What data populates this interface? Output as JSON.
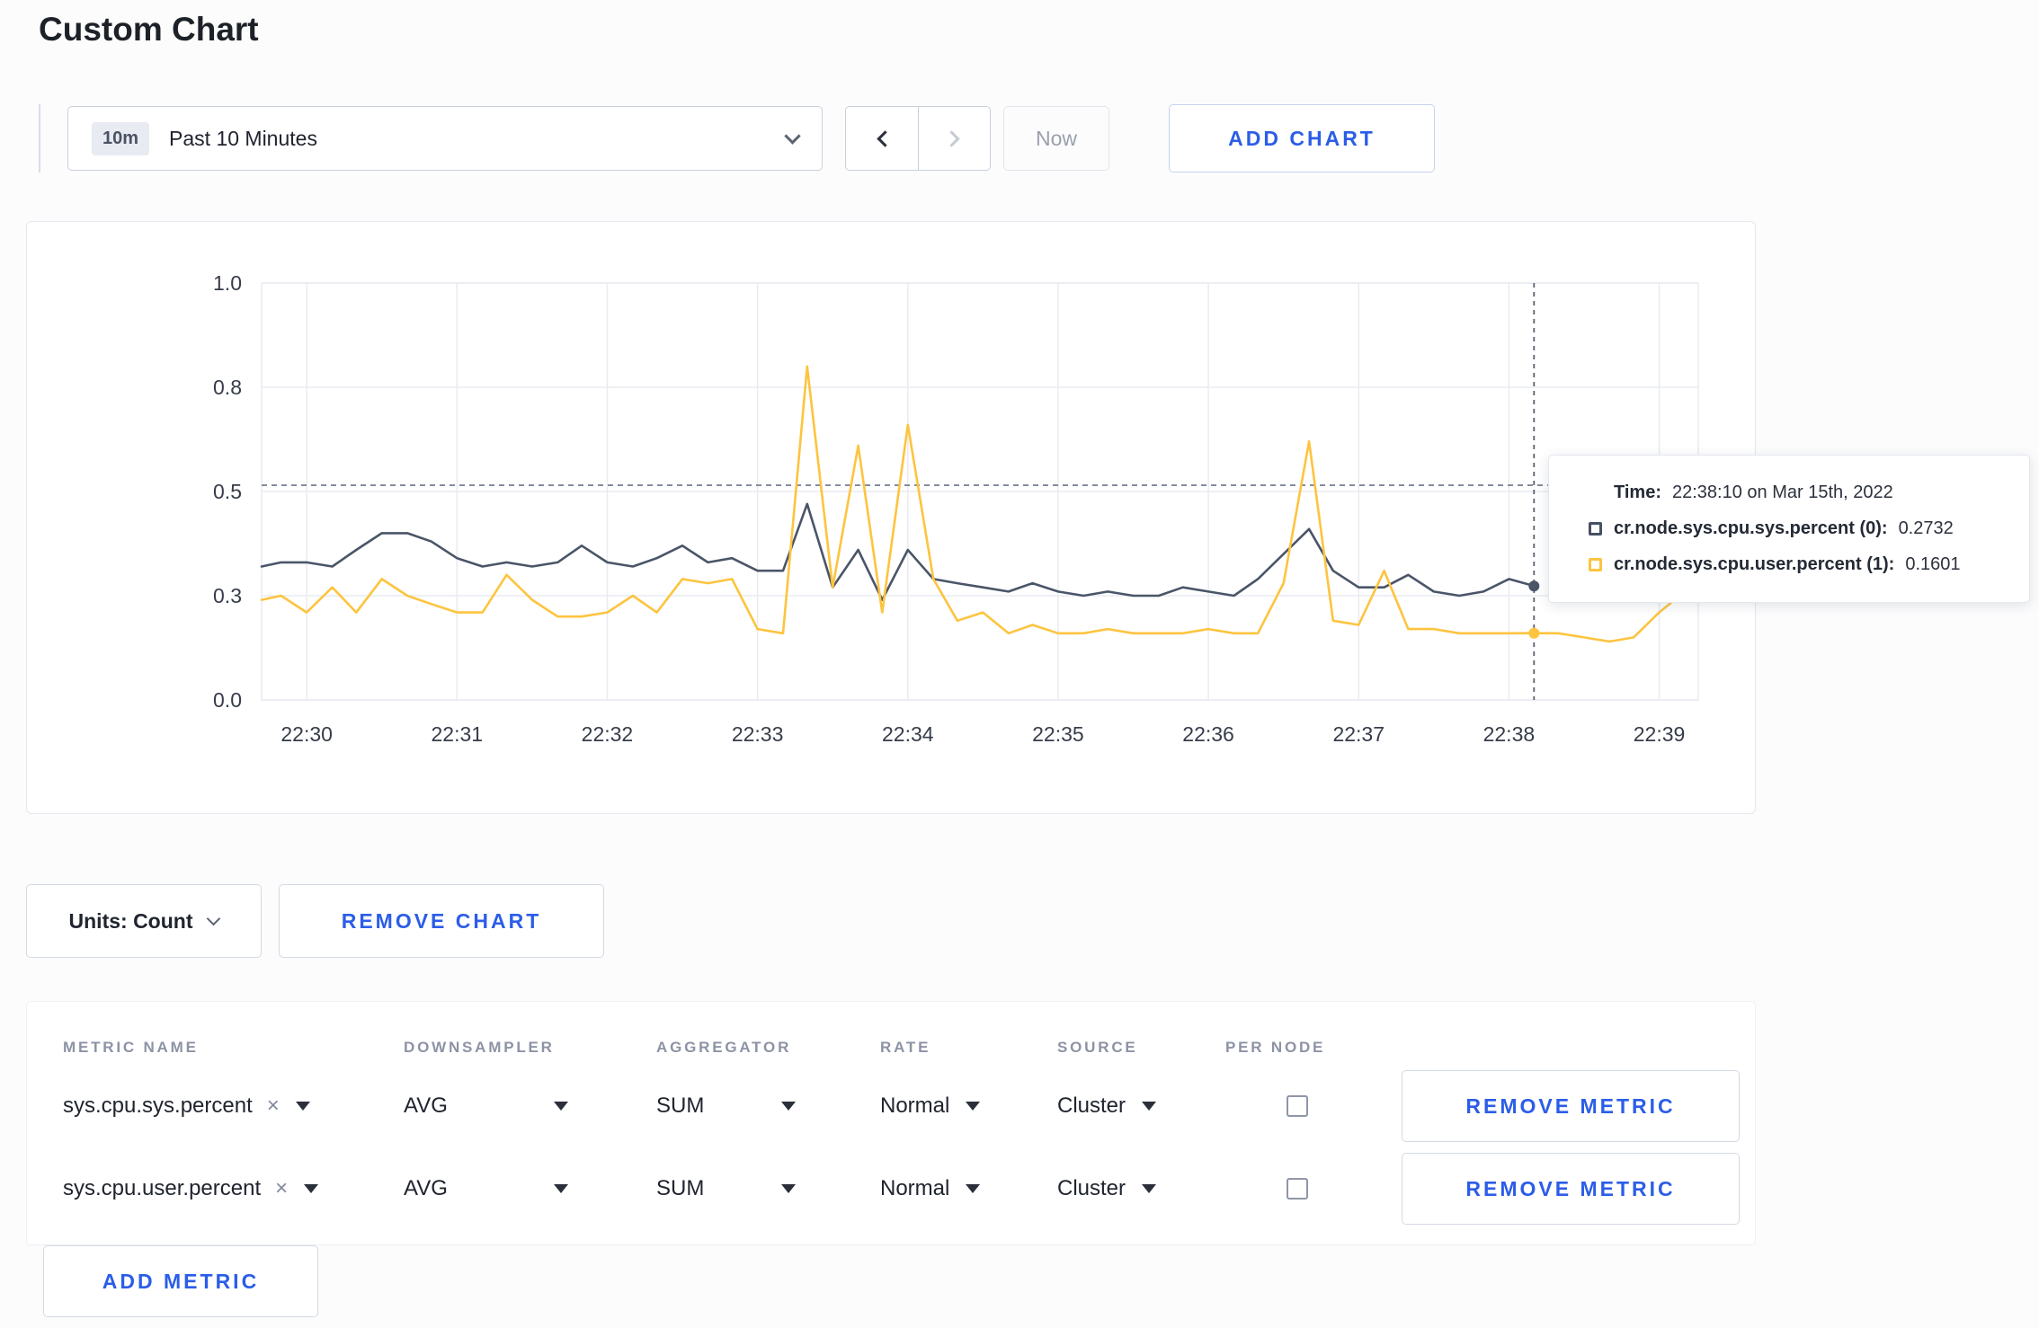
{
  "page": {
    "title": "Custom Chart"
  },
  "toolbar": {
    "range_badge": "10m",
    "range_label": "Past 10 Minutes",
    "now_label": "Now",
    "add_chart_label": "ADD CHART"
  },
  "chart_controls": {
    "units_label": "Units: Count",
    "remove_chart_label": "REMOVE CHART",
    "add_metric_label": "ADD METRIC"
  },
  "tooltip": {
    "time_label": "Time:",
    "time_value": "22:38:10 on Mar 15th, 2022",
    "series": [
      {
        "label": "cr.node.sys.cpu.sys.percent (0):",
        "value": "0.2732",
        "color": "#475064"
      },
      {
        "label": "cr.node.sys.cpu.user.percent (1):",
        "value": "0.1601",
        "color": "#fdc43f"
      }
    ]
  },
  "metrics_table": {
    "headers": [
      "METRIC NAME",
      "DOWNSAMPLER",
      "AGGREGATOR",
      "RATE",
      "SOURCE",
      "PER NODE"
    ],
    "icons": {
      "clear": "×"
    },
    "rows": [
      {
        "metric": "sys.cpu.sys.percent",
        "downsampler": "AVG",
        "aggregator": "SUM",
        "rate": "Normal",
        "source": "Cluster",
        "per_node": false,
        "remove_label": "REMOVE METRIC"
      },
      {
        "metric": "sys.cpu.user.percent",
        "downsampler": "AVG",
        "aggregator": "SUM",
        "rate": "Normal",
        "source": "Cluster",
        "per_node": false,
        "remove_label": "REMOVE METRIC"
      }
    ]
  },
  "chart_data": {
    "type": "line",
    "title": "",
    "xlabel": "",
    "ylabel": "",
    "ylim": [
      0.0,
      1.0
    ],
    "grid": true,
    "t_min": -0.3,
    "t_max": 9.26,
    "y_max": 1.0,
    "threshold_y": 0.515,
    "crosshair_t": 8.167,
    "x_ticks": [
      {
        "t": 0,
        "label": "22:30"
      },
      {
        "t": 1,
        "label": "22:31"
      },
      {
        "t": 2,
        "label": "22:32"
      },
      {
        "t": 3,
        "label": "22:33"
      },
      {
        "t": 4,
        "label": "22:34"
      },
      {
        "t": 5,
        "label": "22:35"
      },
      {
        "t": 6,
        "label": "22:36"
      },
      {
        "t": 7,
        "label": "22:37"
      },
      {
        "t": 8,
        "label": "22:38"
      },
      {
        "t": 9,
        "label": "22:39"
      }
    ],
    "y_ticks": [
      {
        "pos": 1.0,
        "label": "1.0"
      },
      {
        "pos": 0.75,
        "label": "0.8"
      },
      {
        "pos": 0.5,
        "label": "0.5"
      },
      {
        "pos": 0.25,
        "label": "0.3"
      },
      {
        "pos": 0.0,
        "label": "0.0"
      }
    ],
    "series": [
      {
        "name": "cr.node.sys.cpu.sys.percent",
        "color": "#4a5568",
        "crosshair_value": 0.2732,
        "points": [
          [
            -0.3,
            0.32
          ],
          [
            -0.17,
            0.33
          ],
          [
            0,
            0.33
          ],
          [
            0.17,
            0.32
          ],
          [
            0.33,
            0.36
          ],
          [
            0.5,
            0.4
          ],
          [
            0.67,
            0.4
          ],
          [
            0.83,
            0.38
          ],
          [
            1,
            0.34
          ],
          [
            1.17,
            0.32
          ],
          [
            1.33,
            0.33
          ],
          [
            1.5,
            0.32
          ],
          [
            1.67,
            0.33
          ],
          [
            1.83,
            0.37
          ],
          [
            2,
            0.33
          ],
          [
            2.17,
            0.32
          ],
          [
            2.33,
            0.34
          ],
          [
            2.5,
            0.37
          ],
          [
            2.67,
            0.33
          ],
          [
            2.83,
            0.34
          ],
          [
            3,
            0.31
          ],
          [
            3.17,
            0.31
          ],
          [
            3.33,
            0.47
          ],
          [
            3.5,
            0.27
          ],
          [
            3.67,
            0.36
          ],
          [
            3.83,
            0.24
          ],
          [
            4,
            0.36
          ],
          [
            4.17,
            0.29
          ],
          [
            4.33,
            0.28
          ],
          [
            4.5,
            0.27
          ],
          [
            4.67,
            0.26
          ],
          [
            4.83,
            0.28
          ],
          [
            5,
            0.26
          ],
          [
            5.17,
            0.25
          ],
          [
            5.33,
            0.26
          ],
          [
            5.5,
            0.25
          ],
          [
            5.67,
            0.25
          ],
          [
            5.83,
            0.27
          ],
          [
            6,
            0.26
          ],
          [
            6.17,
            0.25
          ],
          [
            6.33,
            0.29
          ],
          [
            6.5,
            0.35
          ],
          [
            6.67,
            0.41
          ],
          [
            6.83,
            0.31
          ],
          [
            7,
            0.27
          ],
          [
            7.17,
            0.27
          ],
          [
            7.33,
            0.3
          ],
          [
            7.5,
            0.26
          ],
          [
            7.67,
            0.25
          ],
          [
            7.83,
            0.26
          ],
          [
            8,
            0.29
          ],
          [
            8.17,
            0.2732
          ]
        ]
      },
      {
        "name": "cr.node.sys.cpu.user.percent",
        "color": "#fdc43f",
        "crosshair_value": 0.1601,
        "points": [
          [
            -0.3,
            0.24
          ],
          [
            -0.17,
            0.25
          ],
          [
            0,
            0.21
          ],
          [
            0.17,
            0.27
          ],
          [
            0.33,
            0.21
          ],
          [
            0.5,
            0.29
          ],
          [
            0.67,
            0.25
          ],
          [
            0.83,
            0.23
          ],
          [
            1,
            0.21
          ],
          [
            1.17,
            0.21
          ],
          [
            1.33,
            0.3
          ],
          [
            1.5,
            0.24
          ],
          [
            1.67,
            0.2
          ],
          [
            1.83,
            0.2
          ],
          [
            2,
            0.21
          ],
          [
            2.17,
            0.25
          ],
          [
            2.33,
            0.21
          ],
          [
            2.5,
            0.29
          ],
          [
            2.67,
            0.28
          ],
          [
            2.83,
            0.29
          ],
          [
            3,
            0.17
          ],
          [
            3.17,
            0.16
          ],
          [
            3.33,
            0.8
          ],
          [
            3.5,
            0.27
          ],
          [
            3.67,
            0.61
          ],
          [
            3.83,
            0.21
          ],
          [
            4,
            0.66
          ],
          [
            4.17,
            0.29
          ],
          [
            4.33,
            0.19
          ],
          [
            4.5,
            0.21
          ],
          [
            4.67,
            0.16
          ],
          [
            4.83,
            0.18
          ],
          [
            5,
            0.16
          ],
          [
            5.17,
            0.16
          ],
          [
            5.33,
            0.17
          ],
          [
            5.5,
            0.16
          ],
          [
            5.67,
            0.16
          ],
          [
            5.83,
            0.16
          ],
          [
            6,
            0.17
          ],
          [
            6.17,
            0.16
          ],
          [
            6.33,
            0.16
          ],
          [
            6.5,
            0.28
          ],
          [
            6.67,
            0.62
          ],
          [
            6.83,
            0.19
          ],
          [
            7,
            0.18
          ],
          [
            7.17,
            0.31
          ],
          [
            7.33,
            0.17
          ],
          [
            7.5,
            0.17
          ],
          [
            7.67,
            0.16
          ],
          [
            7.83,
            0.16
          ],
          [
            8,
            0.16
          ],
          [
            8.17,
            0.1601
          ],
          [
            8.33,
            0.16
          ],
          [
            8.5,
            0.15
          ],
          [
            8.67,
            0.14
          ],
          [
            8.83,
            0.15
          ],
          [
            9,
            0.21
          ],
          [
            9.17,
            0.26
          ]
        ]
      }
    ]
  }
}
